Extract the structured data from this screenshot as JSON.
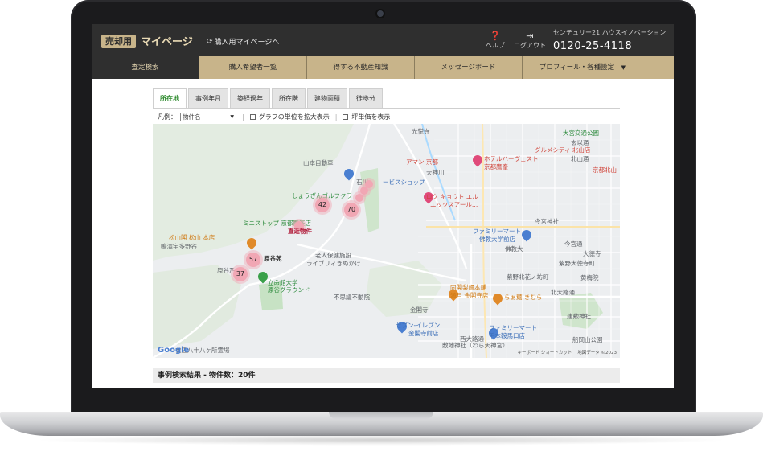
{
  "header": {
    "sell_badge": "売却用",
    "title": "マイページ",
    "buy_link": "購入用マイページへ",
    "help": "ヘルプ",
    "logout": "ログアウト",
    "company": "センチュリー21 ハウスイノベーション",
    "phone": "0120-25-4118"
  },
  "nav": {
    "items": [
      {
        "label": "査定検索"
      },
      {
        "label": "購入希望者一覧"
      },
      {
        "label": "得する不動産知識"
      },
      {
        "label": "メッセージボード"
      },
      {
        "label": "プロフィール・各種設定"
      }
    ]
  },
  "tabs": [
    {
      "label": "所在地"
    },
    {
      "label": "事例年月"
    },
    {
      "label": "築経過年"
    },
    {
      "label": "所在階"
    },
    {
      "label": "建物面積"
    },
    {
      "label": "徒歩分"
    }
  ],
  "legend": {
    "label": "凡例：",
    "select_value": "物件名",
    "option_enlarge": "グラフの単位を拡大表示",
    "option_tsubo": "坪単価を表示"
  },
  "map": {
    "labels": {
      "l1": "光悦寺",
      "l2": "山本自動車",
      "l3": "石川",
      "l4": "ービスショップ",
      "l5": "アマン 京都",
      "l6": "ホテルハーヴェスト",
      "l7": "京都鷹峯",
      "l8": "大宮交通公園",
      "l9": "グルメシティ 北山店",
      "l10": "玄以通",
      "l11": "北山通",
      "l12": "京都北山",
      "l13": "しょうざんゴルフクラ",
      "l14": "ロク キョウト エル",
      "l15": "エックスアール…",
      "l16": "天神川",
      "l17": "ミニストップ 京都鷹峯店",
      "l18": "今宮神社",
      "l19": "松山閣 松山 本店",
      "l20": "鳴滝宇多野谷",
      "l21": "原谷苑",
      "l22": "ファミリーマート",
      "l23": "佛教大学前店",
      "l24": "今宮通",
      "l25": "老人保健施設",
      "l26": "ライブリィきぬかけ",
      "l27": "大徳寺",
      "l28": "佛教大",
      "l29": "紫野大徳寺町",
      "l30": "原谷乃",
      "l31": "立命館大学",
      "l32": "原谷グラウンド",
      "l33": "紫野北花ノ坊町",
      "l34": "黄梅院",
      "l35": "同閣梨饅本舗",
      "l36": "満月 金閣寺店",
      "l37": "らぁ麺 きむら",
      "l38": "北大路通",
      "l39": "不思議不動院",
      "l40": "金閣寺",
      "l41": "建勲神社",
      "l42": "セブン-イレブン",
      "l43": "金閣寺前店",
      "l44": "ファミリーマート",
      "l45": "千本鞍馬口店",
      "l46": "西大路通",
      "l47": "船岡山公園",
      "l48": "敷地神社（わら天神宮）",
      "l49": "衣笠八十八ヶ所霊場",
      "l50": "キーボード ショートカット",
      "l51": "地図データ ©2023"
    },
    "clusters": [
      {
        "label": "42"
      },
      {
        "label": "70"
      },
      {
        "label": "57"
      },
      {
        "label": "37"
      }
    ],
    "marker_text": "直近物件",
    "google": "Google"
  },
  "results": {
    "title": "事例検索結果 - 物件数：20件"
  },
  "colors": {
    "gold": "#c8b48a",
    "dark": "#2f2f2f",
    "active_tab": "#2e8b2e",
    "cluster": "#f1a7b4"
  }
}
